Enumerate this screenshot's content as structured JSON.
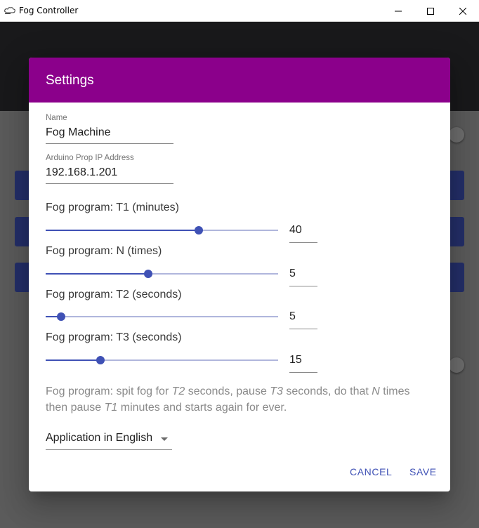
{
  "window": {
    "title": "Fog Controller",
    "controls": [
      "minimize-icon",
      "maximize-icon",
      "close-icon"
    ]
  },
  "dialog": {
    "title": "Settings",
    "name_field": {
      "label": "Name",
      "value": "Fog Machine"
    },
    "ip_field": {
      "label": "Arduino Prop IP Address",
      "value": "192.168.1.201"
    },
    "sliders": [
      {
        "label": "Fog program: T1 (minutes)",
        "value": "40",
        "fraction": 0.66
      },
      {
        "label": "Fog program: N (times)",
        "value": "5",
        "fraction": 0.44
      },
      {
        "label": "Fog program: T2 (seconds)",
        "value": "5",
        "fraction": 0.066
      },
      {
        "label": "Fog program: T3 (seconds)",
        "value": "15",
        "fraction": 0.235
      }
    ],
    "help": {
      "p1": "Fog program: spit fog for ",
      "t2": "T2",
      "p2": " seconds, pause ",
      "t3": "T3",
      "p3": " seconds, do that ",
      "n": "N",
      "p4": " times then pause ",
      "t1": "T1",
      "p5": " minutes and starts again for ever."
    },
    "language_select": {
      "value": "Application in English"
    },
    "actions": {
      "cancel": "CANCEL",
      "save": "SAVE"
    }
  },
  "colors": {
    "header": "#8b008b",
    "accent": "#3f51b5",
    "rail": "#b0b6dc"
  }
}
